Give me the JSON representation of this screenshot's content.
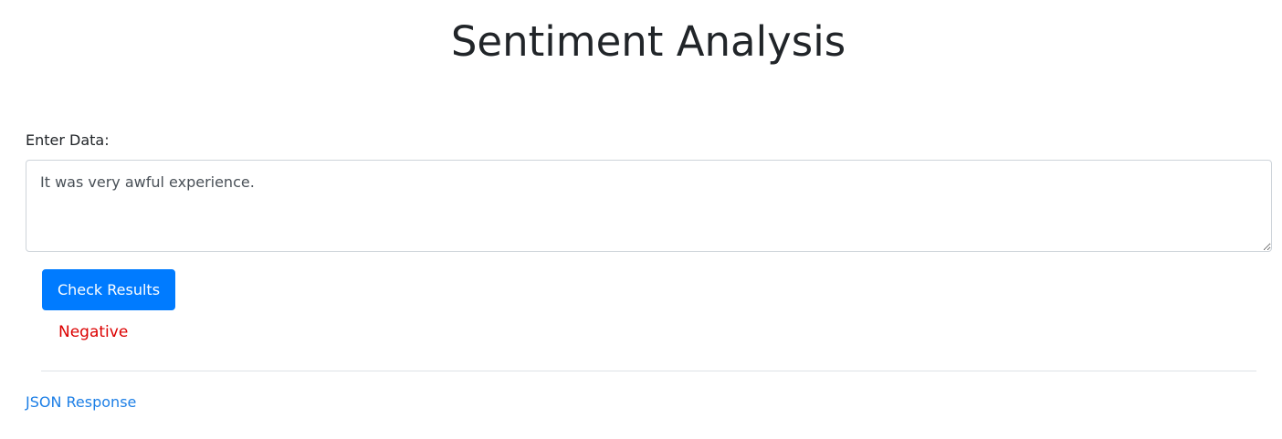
{
  "page": {
    "title": "Sentiment Analysis"
  },
  "form": {
    "label": "Enter Data:",
    "input_value": "It was very awful experience.",
    "button_label": "Check Results"
  },
  "result": {
    "text": "Negative",
    "color": "#dc0000"
  },
  "footer": {
    "link_label": "JSON Response"
  },
  "colors": {
    "accent": "#007bff",
    "link": "#1d7fe6",
    "text": "#212529"
  }
}
